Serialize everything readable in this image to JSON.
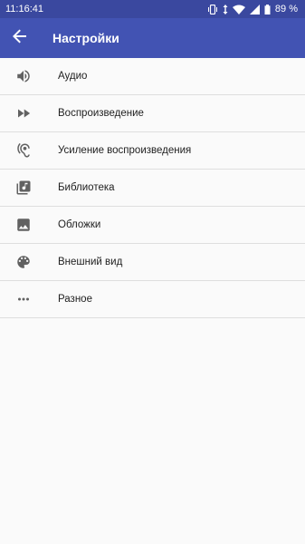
{
  "status": {
    "time": "11:16:41",
    "battery": "89 %"
  },
  "appbar": {
    "title": "Настройки",
    "back_icon": "arrow-back-icon"
  },
  "colors": {
    "statusbar": "#3a489f",
    "appbar": "#4253b3",
    "icon": "#616161",
    "text": "#212121",
    "divider": "#dedede"
  },
  "settings": [
    {
      "label": "Аудио",
      "icon": "volume-icon"
    },
    {
      "label": "Воспроизведение",
      "icon": "fast-forward-icon"
    },
    {
      "label": "Усиление воспроизведения",
      "icon": "hearing-icon"
    },
    {
      "label": "Библиотека",
      "icon": "library-music-icon"
    },
    {
      "label": "Обложки",
      "icon": "image-icon"
    },
    {
      "label": "Внешний вид",
      "icon": "palette-icon"
    },
    {
      "label": "Разное",
      "icon": "more-horiz-icon"
    }
  ]
}
